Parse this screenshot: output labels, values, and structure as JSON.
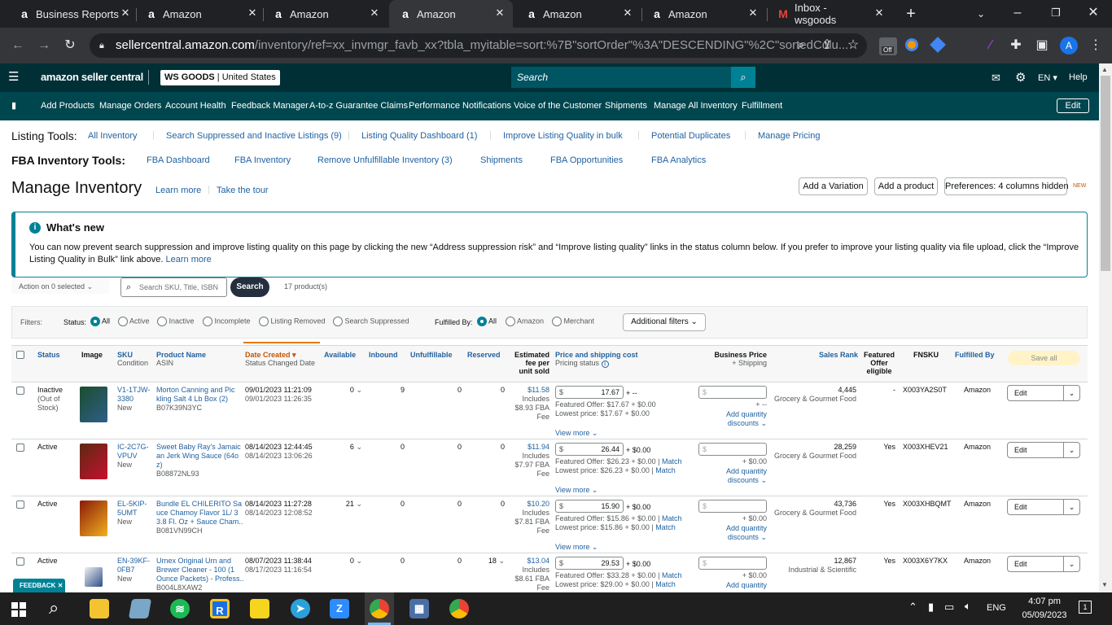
{
  "browser": {
    "tabs": [
      {
        "label": "Business Reports",
        "favicon": "a",
        "active": false
      },
      {
        "label": "Amazon",
        "favicon": "a",
        "active": false
      },
      {
        "label": "Amazon",
        "favicon": "a",
        "active": false
      },
      {
        "label": "Amazon",
        "favicon": "a",
        "active": true
      },
      {
        "label": "Amazon",
        "favicon": "a",
        "active": false
      },
      {
        "label": "Amazon",
        "favicon": "a",
        "active": false
      },
      {
        "label": "Inbox - wsgoods",
        "favicon": "M",
        "active": false
      }
    ],
    "url_domain": "sellercentral.amazon.com",
    "url_path": "/inventory/ref=xx_invmgr_favb_xx?tbla_myitable=sort:%7B\"sortOrder\"%3A\"DESCENDING\"%2C\"sortedColu...",
    "profile_initial": "A",
    "ext_badge": "Off"
  },
  "header": {
    "logo": "amazon seller central",
    "store_bold": "WS GOODS",
    "store_region": "United States",
    "search_placeholder": "Search",
    "lang": "EN",
    "help": "Help"
  },
  "nav": {
    "items": [
      "Add Products",
      "Manage Orders",
      "Account Health",
      "Feedback Manager",
      "A-to-z Guarantee Claims",
      "Performance Notifications",
      "Voice of the Customer",
      "Shipments",
      "Manage All Inventory",
      "Fulfillment"
    ],
    "edit": "Edit"
  },
  "listing_tools": {
    "label": "Listing Tools:",
    "links": [
      "All Inventory",
      "Search Suppressed and Inactive Listings (9)",
      "Listing Quality Dashboard (1)",
      "Improve Listing Quality in bulk",
      "Potential Duplicates",
      "Manage Pricing"
    ]
  },
  "fba_tools": {
    "label": "FBA Inventory Tools:",
    "links": [
      "FBA Dashboard",
      "FBA Inventory",
      "Remove Unfulfillable Inventory (3)",
      "Shipments",
      "FBA Opportunities",
      "FBA Analytics"
    ]
  },
  "page": {
    "title": "Manage Inventory",
    "learn_more": "Learn more",
    "take_tour": "Take the tour",
    "add_variation": "Add a Variation",
    "add_product": "Add a product",
    "preferences": "Preferences: 4 columns hidden",
    "new_badge": "NEW"
  },
  "whats_new": {
    "title": "What's new",
    "text": "You can now prevent search suppression and improve listing quality on this page by clicking the new “Address suppression risk” and “Improve listing quality” links in the status column below. If you prefer to improve your listing quality via file upload, click the “Improve Listing Quality in Bulk” link above.",
    "learn_more": "Learn more"
  },
  "actions": {
    "action_select": "Action on 0 selected",
    "search_placeholder": "Search SKU, Title, ISBN",
    "search_btn": "Search",
    "count": "17 product(s)"
  },
  "filters": {
    "label": "Filters:",
    "status_label": "Status:",
    "status_opts": [
      "All",
      "Active",
      "Inactive",
      "Incomplete",
      "Listing Removed",
      "Search Suppressed"
    ],
    "fulfilled_label": "Fulfilled By:",
    "fulfilled_opts": [
      "All",
      "Amazon",
      "Merchant"
    ],
    "additional": "Additional filters"
  },
  "columns": {
    "status": "Status",
    "image": "Image",
    "sku": "SKU",
    "condition": "Condition",
    "product_name": "Product Name",
    "asin": "ASIN",
    "date_created": "Date Created",
    "status_changed": "Status Changed Date",
    "available": "Available",
    "inbound": "Inbound",
    "unfulfillable": "Unfulfillable",
    "reserved": "Reserved",
    "fee_1": "Estimated",
    "fee_2": "fee per",
    "fee_3": "unit sold",
    "price": "Price and shipping cost",
    "pricing_status": "Pricing status",
    "business_price": "Business Price",
    "shipping_sub": "+ Shipping",
    "sales_rank": "Sales Rank",
    "featured_1": "Featured",
    "featured_2": "Offer",
    "featured_3": "eligible",
    "fnsku": "FNSKU",
    "fulfilled_by": "Fulfilled By",
    "save_all": "Save all"
  },
  "rows": [
    {
      "status1": "Inactive",
      "status2": "(Out of",
      "status3": "Stock)",
      "sku1": "V1-1TJW-",
      "sku2": "3380",
      "cond": "New",
      "name1": "Morton Canning and Pic",
      "name2": "kling Salt 4 Lb Box (2)",
      "name3": "",
      "asin": "B07K39N3YC",
      "date1": "09/01/2023 11:21:09",
      "date2": "09/01/2023 11:26:35",
      "available": "0",
      "inbound": "9",
      "unful": "0",
      "reserved": "0",
      "fee1": "$11.58",
      "fee2": "Includes",
      "fee3": "$8.93 FBA",
      "fee4": "Fee",
      "price": "17.67",
      "ship": "+ --",
      "featured": "Featured Offer: $17.67 + $0.00",
      "lowest": "Lowest price: $17.67 + $0.00",
      "bp_ship": "+ --",
      "qty_link": "Add quantity",
      "qty_link2": "discounts",
      "rank": "4,445",
      "cat": "Grocery & Gourmet Food",
      "feat": "-",
      "fnsku": "X003YA2S0T",
      "fulfilled": "Amazon",
      "edit": "Edit",
      "view_more": "View more",
      "match": false
    },
    {
      "status1": "Active",
      "status2": "",
      "status3": "",
      "sku1": "IC-2C7G-",
      "sku2": "VPUV",
      "cond": "New",
      "name1": "Sweet Baby Ray's Jamaic",
      "name2": "an Jerk Wing Sauce (64o",
      "name3": "z)",
      "asin": "B08872NL93",
      "date1": "08/14/2023 12:44:45",
      "date2": "08/14/2023 13:06:26",
      "available": "6",
      "inbound": "0",
      "unful": "0",
      "reserved": "0",
      "fee1": "$11.94",
      "fee2": "Includes",
      "fee3": "$7.97 FBA",
      "fee4": "Fee",
      "price": "26.44",
      "ship": "+ $0.00",
      "featured": "Featured Offer: $26.23 + $0.00",
      "lowest": "Lowest price: $26.23 + $0.00",
      "bp_ship": "+ $0.00",
      "qty_link": "Add quantity",
      "qty_link2": "discounts",
      "rank": "28,259",
      "cat": "Grocery & Gourmet Food",
      "feat": "Yes",
      "fnsku": "X003XHEV21",
      "fulfilled": "Amazon",
      "edit": "Edit",
      "view_more": "View more",
      "match": true
    },
    {
      "status1": "Active",
      "status2": "",
      "status3": "",
      "sku1": "EL-5KIP-",
      "sku2": "5UMT",
      "cond": "New",
      "name1": "Bundle EL CHILERITO Sa",
      "name2": "uce Chamoy Flavor 1L/ 3",
      "name3": "3.8 Fl. Oz + Sauce Cham..",
      "asin": "B081VN99CH",
      "date1": "08/14/2023 11:27:28",
      "date2": "08/14/2023 12:08:52",
      "available": "21",
      "inbound": "0",
      "unful": "0",
      "reserved": "0",
      "fee1": "$10.20",
      "fee2": "Includes",
      "fee3": "$7.81 FBA",
      "fee4": "Fee",
      "price": "15.90",
      "ship": "+ $0.00",
      "featured": "Featured Offer: $15.86 + $0.00",
      "lowest": "Lowest price: $15.86 + $0.00",
      "bp_ship": "+ $0.00",
      "qty_link": "Add quantity",
      "qty_link2": "discounts",
      "rank": "43,736",
      "cat": "Grocery & Gourmet Food",
      "feat": "Yes",
      "fnsku": "X003XHBQMT",
      "fulfilled": "Amazon",
      "edit": "Edit",
      "view_more": "View more",
      "match": true
    },
    {
      "status1": "Active",
      "status2": "",
      "status3": "",
      "sku1": "EN-39KF-",
      "sku2": "0FB7",
      "cond": "New",
      "name1": "Urnex Original Urn and",
      "name2": "Brewer Cleaner - 100 (1",
      "name3": "Ounce Packets) - Profess..",
      "asin": "B004L8XAW2",
      "date1": "08/07/2023 11:38:44",
      "date2": "08/17/2023 11:16:54",
      "available": "0",
      "inbound": "0",
      "unful": "0",
      "reserved": "18",
      "fee1": "$13.04",
      "fee2": "Includes",
      "fee3": "$8.61 FBA",
      "fee4": "Fee",
      "price": "29.53",
      "ship": "+ $0.00",
      "featured": "Featured Offer: $33.28 + $0.00",
      "lowest": "Lowest price: $29.00 + $0.00",
      "bp_ship": "+ $0.00",
      "qty_link": "Add quantity",
      "qty_link2": "",
      "rank": "12,867",
      "cat": "Industrial & Scientific",
      "feat": "Yes",
      "fnsku": "X003X6Y7KX",
      "fulfilled": "Amazon",
      "edit": "Edit",
      "view_more": "",
      "match": true
    }
  ],
  "match_label": "Match",
  "feedback": "FEEDBACK",
  "taskbar": {
    "lang": "ENG",
    "time": "4:07 pm",
    "date": "05/09/2023"
  }
}
